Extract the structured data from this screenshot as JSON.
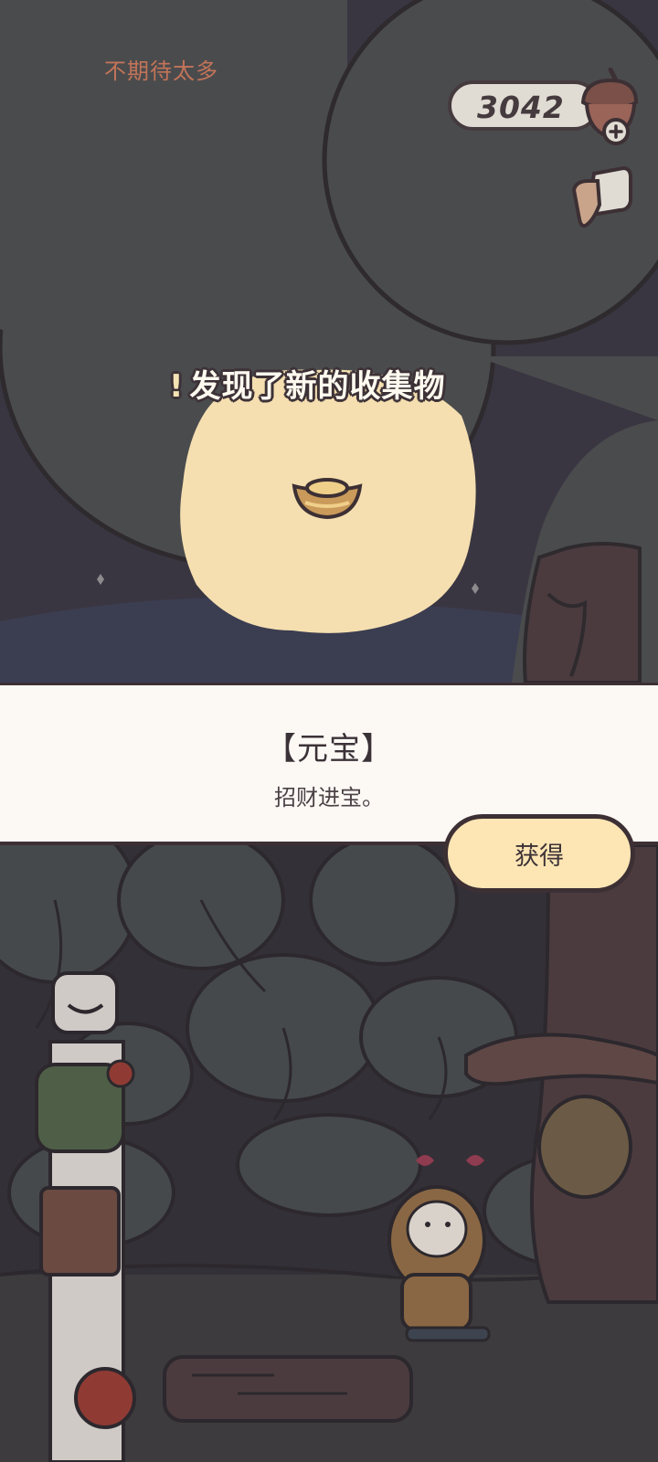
{
  "header": {
    "label": "不期待太多"
  },
  "acorn_counter": {
    "value": "3042",
    "icon": "acorn-icon",
    "add_icon": "plus-icon"
  },
  "pointer": {
    "icon": "pointing-hand-icon"
  },
  "discovery": {
    "exclamation": "!",
    "message": "发现了新的收集物"
  },
  "item": {
    "icon": "gold-ingot-icon",
    "name": "【元宝】",
    "description": "招财进宝。"
  },
  "action": {
    "get_label": "获得"
  },
  "colors": {
    "panel_bg": "#fcf9f5",
    "button_bg": "#fde6b4",
    "label_accent": "#c27459",
    "spotlight": "#f5dfb0",
    "outline": "#3d3034"
  }
}
